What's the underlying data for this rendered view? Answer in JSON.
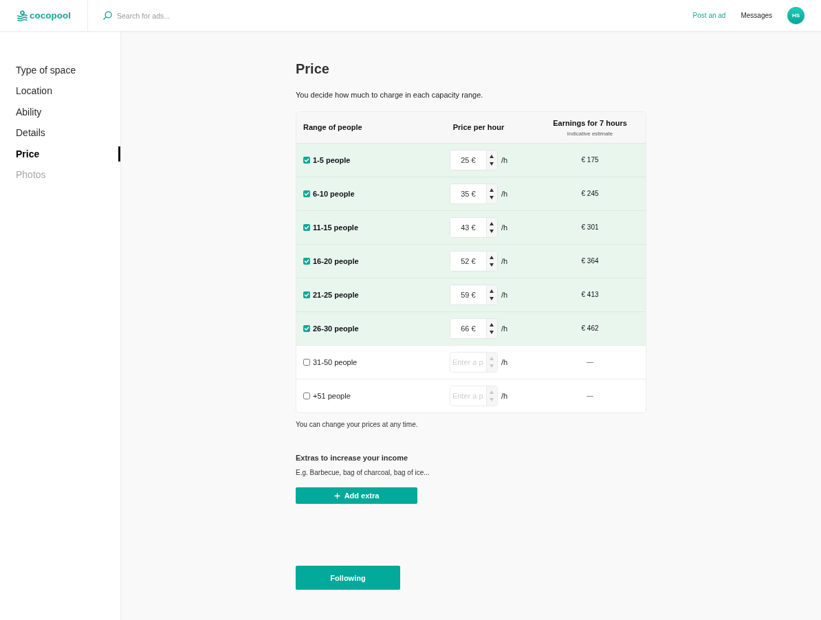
{
  "header": {
    "logo": "cocopool",
    "search": {
      "placeholder": "Search for ads..."
    },
    "links": [
      {
        "label": "Post an ad",
        "kind": "accent"
      },
      {
        "label": "Messages",
        "kind": "plain"
      }
    ],
    "avatar": "HS"
  },
  "sidebar": {
    "items": [
      {
        "label": "Type of space",
        "selected": false,
        "disabled": false
      },
      {
        "label": "Location",
        "selected": false,
        "disabled": false
      },
      {
        "label": "Ability",
        "selected": false,
        "disabled": false
      },
      {
        "label": "Details",
        "selected": false,
        "disabled": false
      },
      {
        "label": "Price",
        "selected": true,
        "disabled": false
      },
      {
        "label": "Photos",
        "selected": false,
        "disabled": true
      }
    ]
  },
  "page": {
    "title": "Price",
    "intro": "You decide how much to charge in each capacity range."
  },
  "table": {
    "columns": [
      {
        "label": "Range of people"
      },
      {
        "label": "Price per hour"
      },
      {
        "label": "Earnings for 7 hours",
        "note": "Indicative estimate"
      }
    ],
    "rows": [
      {
        "range": "1-5 people",
        "checked": true,
        "price": "25 €",
        "unit": "/h",
        "earnings": "€ 175"
      },
      {
        "range": "6-10 people",
        "checked": true,
        "price": "35 €",
        "unit": "/h",
        "earnings": "€ 245"
      },
      {
        "range": "11-15 people",
        "checked": true,
        "price": "43 €",
        "unit": "/h",
        "earnings": "€ 301"
      },
      {
        "range": "16-20 people",
        "checked": true,
        "price": "52 €",
        "unit": "/h",
        "earnings": "€ 364"
      },
      {
        "range": "21-25 people",
        "checked": true,
        "price": "59 €",
        "unit": "/h",
        "earnings": "€ 413"
      },
      {
        "range": "26-30 people",
        "checked": true,
        "price": "66 €",
        "unit": "/h",
        "earnings": "€ 462"
      },
      {
        "range": "31-50 people",
        "checked": false,
        "placeholder": "Enter a p",
        "unit": "/h",
        "earnings": "—"
      },
      {
        "range": "+51 people",
        "checked": false,
        "placeholder": "Enter a p",
        "unit": "/h",
        "earnings": "—"
      }
    ]
  },
  "note": "You can change your prices at any time.",
  "extras": {
    "title": "Extras to increase your income",
    "hint": "E.g. Barbecue, bag of charcoal, bag of ice...",
    "button": "Add extra"
  },
  "next_button": "Following"
}
